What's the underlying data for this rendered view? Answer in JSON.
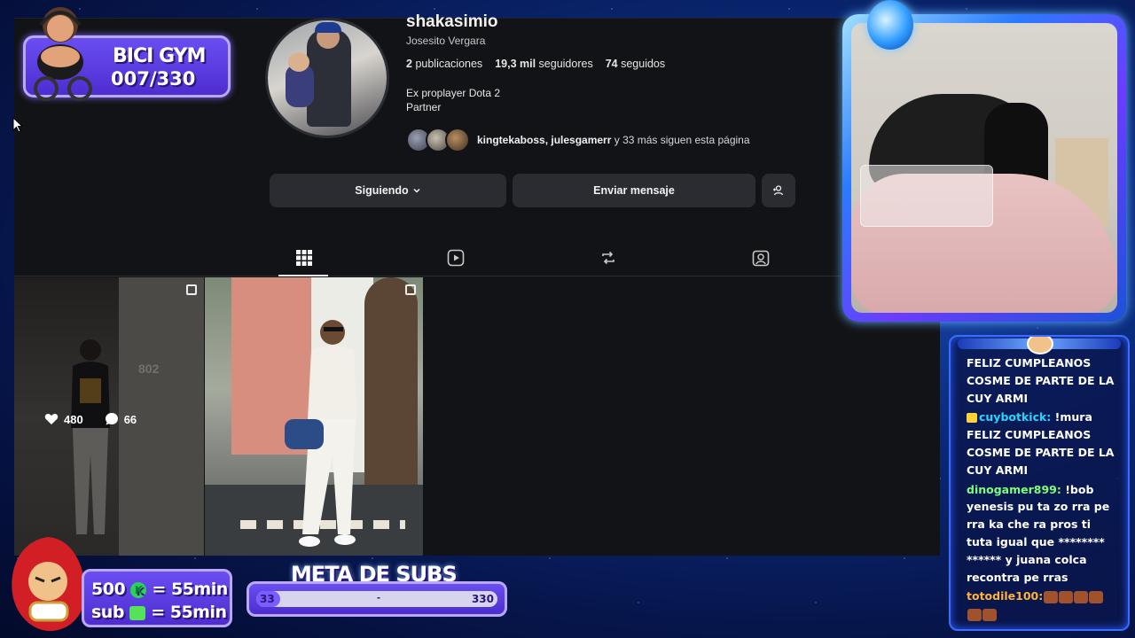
{
  "profile": {
    "username": "shakasimio",
    "full_name": "Josesito Vergara",
    "posts_count": "2",
    "posts_label": "publicaciones",
    "followers_count": "19,3 mil",
    "followers_label": "seguidores",
    "following_count": "74",
    "following_label": "seguidos",
    "bio_line1": "Ex proplayer Dota 2",
    "bio_line2": "Partner",
    "followed_by_names": "kingtekaboss, julesgamerr",
    "followed_by_rest": " y 33 más siguen esta página",
    "follow_button": "Siguiendo",
    "message_button": "Enviar mensaje"
  },
  "tabs": [
    {
      "icon": "grid-icon",
      "active": true
    },
    {
      "icon": "reels-icon",
      "active": false
    },
    {
      "icon": "repost-icon",
      "active": false
    },
    {
      "icon": "tagged-icon",
      "active": false
    }
  ],
  "posts": [
    {
      "likes": "480",
      "comments": "66",
      "sign_text": "802"
    },
    {}
  ],
  "overlays": {
    "bici_title": "BICI GYM",
    "bici_count": "007/330",
    "subs_line1_amount": "500",
    "subs_line1_value": "= 55min",
    "subs_line2_label": "sub",
    "subs_line2_value": "= 55min",
    "meta_title": "META DE SUBS",
    "meta_current": "33",
    "meta_target": "330",
    "meta_separator": "-",
    "meta_progress": 0.1
  },
  "chat": [
    {
      "user": "",
      "text": "FELIZ CUMPLEANOS COSME DE PARTE DE LA CUY ARMI"
    },
    {
      "user": "cuybotkick:",
      "badge": true,
      "color": "u1",
      "text": " !mura FELIZ CUMPLEANOS COSME DE PARTE DE LA CUY ARMI"
    },
    {
      "user": "dinogamer899:",
      "color": "u2",
      "text": " !bob yenesis pu ta zo rra pe rra ka che ra pros ti tuta igual que ******** ****** y juana colca recontra pe rras"
    },
    {
      "user": "totodile100:",
      "color": "u3",
      "text": " "
    }
  ],
  "colors": {
    "ig_bg": "#121316",
    "button_bg": "#2a2c31",
    "accent_purple": "#5a3be0",
    "frame_blue": "#2a7bff"
  }
}
